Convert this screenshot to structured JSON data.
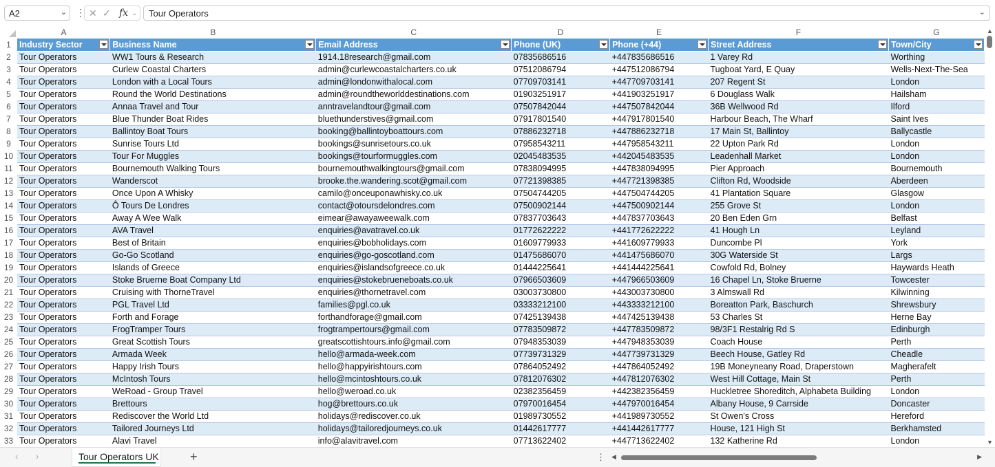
{
  "formula_bar": {
    "name_box": "A2",
    "fx_label": "fx",
    "cancel_glyph": "✕",
    "enter_glyph": "✓",
    "formula_value": "Tour Operators"
  },
  "columns": [
    "A",
    "B",
    "C",
    "D",
    "E",
    "F",
    "G"
  ],
  "header_row_number": "1",
  "headers": [
    "Industry Sector",
    "Business Name",
    "Email Address",
    "Phone (UK)",
    "Phone (+44)",
    "Street Address",
    "Town/City"
  ],
  "rows": [
    [
      "2",
      "Tour Operators",
      "WW1 Tours & Research",
      "1914.18research@gmail.com",
      "07835686516",
      "+447835686516",
      "1 Varey Rd",
      "Worthing"
    ],
    [
      "3",
      "Tour Operators",
      "Curlew Coastal Charters",
      "admin@curlewcoastalcharters.co.uk",
      "07512086794",
      "+447512086794",
      "Tugboat Yard, E Quay",
      "Wells-Next-The-Sea"
    ],
    [
      "4",
      "Tour Operators",
      "London with a Local Tours",
      "admin@londonwithalocal.com",
      "07709703141",
      "+447709703141",
      "207 Regent St",
      "London"
    ],
    [
      "5",
      "Tour Operators",
      "Round the World Destinations",
      "admin@roundtheworlddestinations.com",
      "01903251917",
      "+441903251917",
      "6 Douglass Walk",
      "Hailsham"
    ],
    [
      "6",
      "Tour Operators",
      "Annaa Travel and Tour",
      "anntravelandtour@gmail.com",
      "07507842044",
      "+447507842044",
      "36B Wellwood Rd",
      "Ilford"
    ],
    [
      "7",
      "Tour Operators",
      "Blue Thunder Boat Rides",
      "bluethunderstives@gmail.com",
      "07917801540",
      "+447917801540",
      "Harbour Beach, The Wharf",
      "Saint Ives"
    ],
    [
      "8",
      "Tour Operators",
      "Ballintoy Boat Tours",
      "booking@ballintoyboattours.com",
      "07886232718",
      "+447886232718",
      "17 Main St, Ballintoy",
      "Ballycastle"
    ],
    [
      "9",
      "Tour Operators",
      "Sunrise Tours Ltd",
      "bookings@sunrisetours.co.uk",
      "07958543211",
      "+447958543211",
      "22 Upton Park Rd",
      "London"
    ],
    [
      "10",
      "Tour Operators",
      "Tour For Muggles",
      "bookings@tourformuggles.com",
      "02045483535",
      "+442045483535",
      "Leadenhall Market",
      "London"
    ],
    [
      "11",
      "Tour Operators",
      "Bournemouth Walking Tours",
      "bournemouthwalkingtours@gmail.com",
      "07838094995",
      "+447838094995",
      "Pier Approach",
      "Bournemouth"
    ],
    [
      "12",
      "Tour Operators",
      "Wanderscot",
      "brooke.the.wandering.scot@gmail.com",
      "07721398385",
      "+447721398385",
      "Clifton Rd, Woodside",
      "Aberdeen"
    ],
    [
      "13",
      "Tour Operators",
      "Once Upon A Whisky",
      "camilo@onceuponawhisky.co.uk",
      "07504744205",
      "+447504744205",
      "41 Plantation Square",
      "Glasgow"
    ],
    [
      "14",
      "Tour Operators",
      "Ô Tours De Londres",
      "contact@otoursdelondres.com",
      "07500902144",
      "+447500902144",
      "255 Grove St",
      "London"
    ],
    [
      "15",
      "Tour Operators",
      "Away A Wee Walk",
      "eimear@awayaweewalk.com",
      "07837703643",
      "+447837703643",
      "20 Ben Eden Grn",
      "Belfast"
    ],
    [
      "16",
      "Tour Operators",
      "AVA Travel",
      "enquiries@avatravel.co.uk",
      "01772622222",
      "+441772622222",
      "41 Hough Ln",
      "Leyland"
    ],
    [
      "17",
      "Tour Operators",
      "Best of Britain",
      "enquiries@bobholidays.com",
      "01609779933",
      "+441609779933",
      "Duncombe Pl",
      "York"
    ],
    [
      "18",
      "Tour Operators",
      "Go-Go Scotland",
      "enquiries@go-goscotland.com",
      "01475686070",
      "+441475686070",
      "30G Waterside St",
      "Largs"
    ],
    [
      "19",
      "Tour Operators",
      "Islands of Greece",
      "enquiries@islandsofgreece.co.uk",
      "01444225641",
      "+441444225641",
      "Cowfold Rd, Bolney",
      "Haywards Heath"
    ],
    [
      "20",
      "Tour Operators",
      "Stoke Bruerne Boat Company Ltd",
      "enquiries@stokebrueneboats.co.uk",
      "07966503609",
      "+447966503609",
      "16 Chapel Ln, Stoke Bruerne",
      "Towcester"
    ],
    [
      "21",
      "Tour Operators",
      "Cruising with ThorneTravel",
      "enquiries@thornetravel.com",
      "03003730800",
      "+443003730800",
      "3 Almswall Rd",
      "Kilwinning"
    ],
    [
      "22",
      "Tour Operators",
      "PGL Travel Ltd",
      "families@pgl.co.uk",
      "03333212100",
      "+443333212100",
      "Boreatton Park, Baschurch",
      "Shrewsbury"
    ],
    [
      "23",
      "Tour Operators",
      "Forth and Forage",
      "forthandforage@gmail.com",
      "07425139438",
      "+447425139438",
      "53 Charles St",
      "Herne Bay"
    ],
    [
      "24",
      "Tour Operators",
      "FrogTramper Tours",
      "frogtrampertours@gmail.com",
      "07783509872",
      "+447783509872",
      "98/3F1 Restalrig Rd S",
      "Edinburgh"
    ],
    [
      "25",
      "Tour Operators",
      "Great Scottish Tours",
      "greatscottishtours.info@gmail.com",
      "07948353039",
      "+447948353039",
      "Coach House",
      "Perth"
    ],
    [
      "26",
      "Tour Operators",
      "Armada Week",
      "hello@armada-week.com",
      "07739731329",
      "+447739731329",
      "Beech House, Gatley Rd",
      "Cheadle"
    ],
    [
      "27",
      "Tour Operators",
      "Happy Irish Tours",
      "hello@happyirishtours.com",
      "07864052492",
      "+447864052492",
      "19B Moneyneany Road, Draperstown",
      "Magherafelt"
    ],
    [
      "28",
      "Tour Operators",
      "McIntosh Tours",
      "hello@mcintoshtours.co.uk",
      "07812076302",
      "+447812076302",
      "West Hill Cottage, Main St",
      "Perth"
    ],
    [
      "29",
      "Tour Operators",
      "WeRoad - Group Travel",
      "hello@weroad.co.uk",
      "02382356459",
      "+442382356459",
      "Huckletree Shoreditch, Alphabeta Building",
      "London"
    ],
    [
      "30",
      "Tour Operators",
      "Brettours",
      "hog@brettours.co.uk",
      "07970016454",
      "+447970016454",
      "Albany House, 9 Carrside",
      "Doncaster"
    ],
    [
      "31",
      "Tour Operators",
      "Rediscover the World Ltd",
      "holidays@rediscover.co.uk",
      "01989730552",
      "+441989730552",
      "St Owen's Cross",
      "Hereford"
    ],
    [
      "32",
      "Tour Operators",
      "Tailored Journeys Ltd",
      "holidays@tailoredjourneys.co.uk",
      "01442617777",
      "+441442617777",
      "House, 121 High St",
      "Berkhamsted"
    ],
    [
      "33",
      "Tour Operators",
      "Alavi Travel",
      "info@alavitravel.com",
      "07713622402",
      "+447713622402",
      "132 Katherine Rd",
      "London"
    ]
  ],
  "sheet_tabs": [
    "Tour Operators UK"
  ],
  "bottom": {
    "prev_glyph": "‹",
    "next_glyph": "›",
    "add_glyph": "+",
    "menu_glyph": "⋮"
  },
  "colors": {
    "header_fill": "#5b9bd5",
    "band_fill": "#ddebf7",
    "accent": "#217346"
  }
}
